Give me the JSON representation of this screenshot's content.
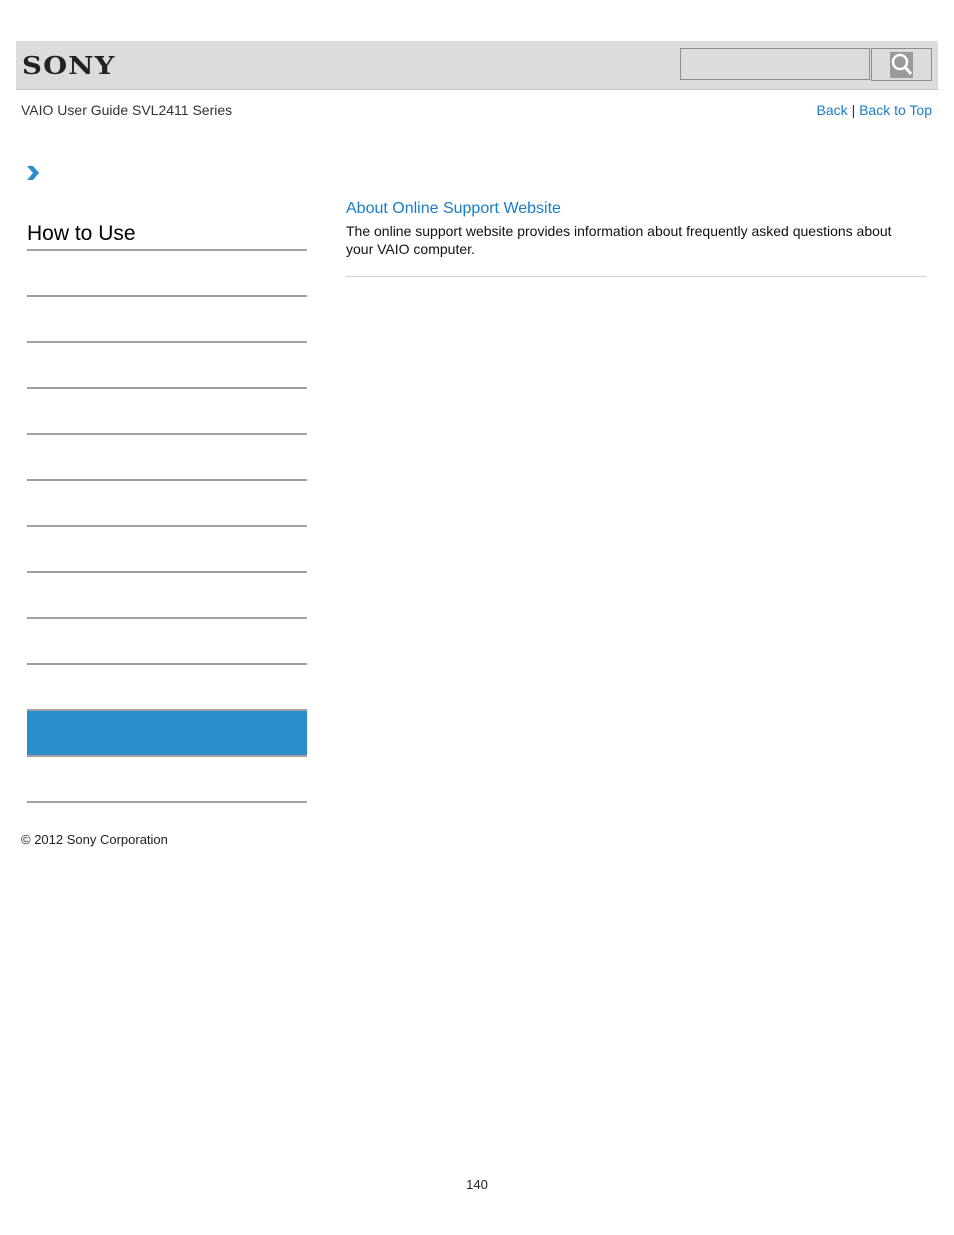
{
  "header": {
    "logo": "SONY",
    "search": {
      "placeholder": "",
      "value": ""
    },
    "search_icon": "search-icon"
  },
  "subheader": {
    "guide_title": "VAIO User Guide SVL2411 Series",
    "links": {
      "back": "Back",
      "separator": "|",
      "back_to_top": "Back to Top"
    }
  },
  "sidebar": {
    "breadcrumb_icon": "chevron-right-icon",
    "title": "How to Use",
    "items": [
      {
        "label": "",
        "active": false
      },
      {
        "label": "",
        "active": false
      },
      {
        "label": "",
        "active": false
      },
      {
        "label": "",
        "active": false
      },
      {
        "label": "",
        "active": false
      },
      {
        "label": "",
        "active": false
      },
      {
        "label": "",
        "active": false
      },
      {
        "label": "",
        "active": false
      },
      {
        "label": "",
        "active": false
      },
      {
        "label": "",
        "active": false
      },
      {
        "label": "",
        "active": true
      },
      {
        "label": "",
        "active": false
      }
    ],
    "active_color": "#2a8ecb"
  },
  "content": {
    "link_title": "About Online Support Website",
    "description": "The online support website provides information about frequently asked questions about your VAIO computer."
  },
  "footer": {
    "copyright": "© 2012 Sony Corporation",
    "page_number": "140"
  },
  "colors": {
    "link": "#1a7dc4",
    "header_bg": "#dcdcdc"
  }
}
